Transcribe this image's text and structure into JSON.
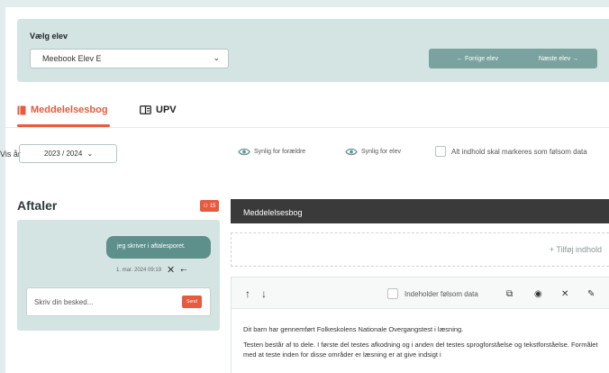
{
  "student": {
    "label": "Vælg elev",
    "selected": "Meebook Elev E",
    "prev_label": "← Forrige elev",
    "next_label": "Næste elev →"
  },
  "tabs": [
    {
      "label": "Meddelelsesbog",
      "active": true,
      "icon": "notebook-icon"
    },
    {
      "label": "UPV",
      "active": false,
      "icon": "columns-icon"
    }
  ],
  "filters": {
    "year_label": "Vis år",
    "year_value": "2023 / 2024",
    "visible_parents": "Synlig for forældre",
    "visible_student": "Synlig for elev",
    "sensitive_all": "Alt indhold skal markeres som følsom data"
  },
  "aftaler": {
    "title": "Aftaler",
    "badge": "15",
    "message": "jeg skriver i aftalesporet.",
    "timestamp": "1. mar. 2024 09:19",
    "placeholder": "Skriv din besked...",
    "send_label": "Send"
  },
  "book": {
    "header": "Meddelelsesbog",
    "add_label": "+ Tilføj indhold",
    "sensitive_label": "Indeholder følsom data",
    "paragraphs": [
      "Dit barn har gennemført Folkeskolens Nationale Overgangstest i læsning.",
      "Testen består af to dele. I første del testes afkodning og i anden del testes sprogforståelse og tekstforståelse. Formålet med at teste inden for disse områder er læsning er at give indsigt i"
    ]
  },
  "colors": {
    "accent": "#e85a3f",
    "teal": "#7aa39f",
    "panel": "#d3e4e3",
    "dark_header": "#3a3a3a"
  }
}
